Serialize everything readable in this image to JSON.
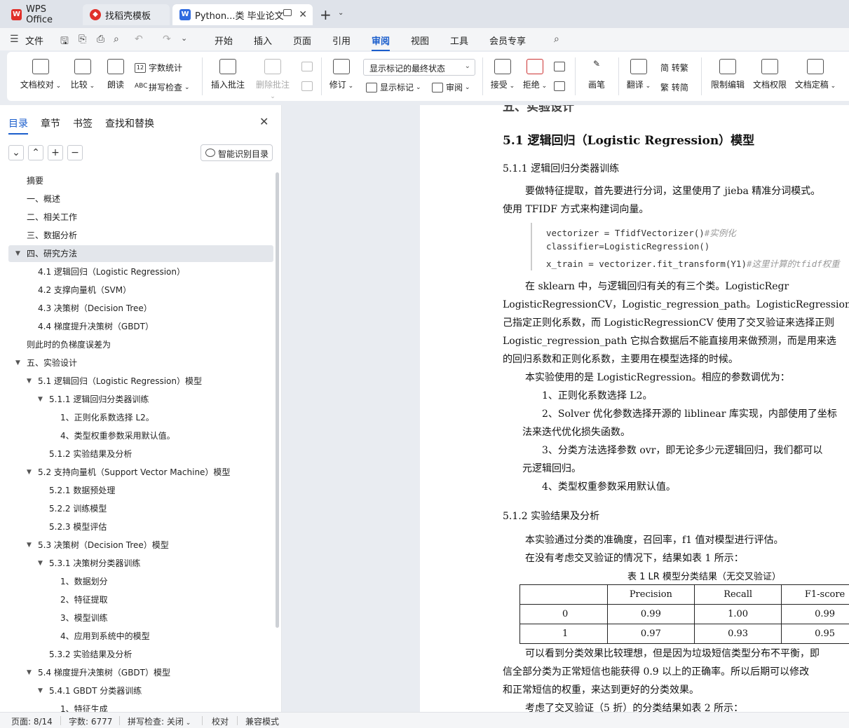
{
  "tabs": {
    "wps": "WPS Office",
    "templates": "找稻壳模板",
    "document": "Python...类 毕业论文"
  },
  "menu": {
    "file": "文件",
    "items": [
      "开始",
      "插入",
      "页面",
      "引用",
      "审阅",
      "视图",
      "工具",
      "会员专享"
    ],
    "active": "审阅"
  },
  "ribbon": {
    "doc_check": "文档校对",
    "compare": "比较",
    "read_aloud": "朗读",
    "word_count": "字数统计",
    "spell_check": "拼写检查",
    "insert_comment": "插入批注",
    "delete_comment": "删除批注",
    "track_changes": "修订",
    "markup_state": "显示标记的最终状态",
    "show_markup": "显示标记",
    "review": "审阅",
    "accept": "接受",
    "reject": "拒绝",
    "pen": "画笔",
    "translate": "翻译",
    "to_traditional": "简 转繁",
    "to_simplified": "繁 转简",
    "restrict_edit": "限制编辑",
    "doc_permission": "文档权限",
    "finalize": "文档定稿"
  },
  "panel": {
    "tabs": [
      "目录",
      "章节",
      "书签",
      "查找和替换"
    ],
    "smart_toc": "智能识别目录",
    "toc": [
      {
        "text": "摘要",
        "level": 0,
        "toggle": ""
      },
      {
        "text": "一、概述",
        "level": 0,
        "toggle": ""
      },
      {
        "text": "二、相关工作",
        "level": 0,
        "toggle": ""
      },
      {
        "text": "三、数据分析",
        "level": 0,
        "toggle": ""
      },
      {
        "text": "四、研究方法",
        "level": 0,
        "toggle": "▼",
        "selected": true
      },
      {
        "text": "4.1 逻辑回归（Logistic Regression）",
        "level": 1,
        "toggle": ""
      },
      {
        "text": "4.2 支撑向量机（SVM）",
        "level": 1,
        "toggle": ""
      },
      {
        "text": "4.3 决策树（Decision Tree）",
        "level": 1,
        "toggle": ""
      },
      {
        "text": "4.4 梯度提升决策树（GBDT）",
        "level": 1,
        "toggle": ""
      },
      {
        "text": "则此时的负梯度误差为",
        "level": 0,
        "toggle": ""
      },
      {
        "text": "五、实验设计",
        "level": 0,
        "toggle": "▼"
      },
      {
        "text": "5.1 逻辑回归（Logistic Regression）模型",
        "level": 1,
        "toggle": "▼"
      },
      {
        "text": "5.1.1 逻辑回归分类器训练",
        "level": 2,
        "toggle": "▼"
      },
      {
        "text": "1、正则化系数选择 L2。",
        "level": 3,
        "toggle": ""
      },
      {
        "text": "4、类型权重参数采用默认值。",
        "level": 3,
        "toggle": ""
      },
      {
        "text": "5.1.2 实验结果及分析",
        "level": 2,
        "toggle": ""
      },
      {
        "text": "5.2 支持向量机（Support Vector Machine）模型",
        "level": 1,
        "toggle": "▼"
      },
      {
        "text": "5.2.1 数据预处理",
        "level": 2,
        "toggle": ""
      },
      {
        "text": "5.2.2 训练模型",
        "level": 2,
        "toggle": ""
      },
      {
        "text": "5.2.3 模型评估",
        "level": 2,
        "toggle": ""
      },
      {
        "text": "5.3 决策树（Decision Tree）模型",
        "level": 1,
        "toggle": "▼"
      },
      {
        "text": "5.3.1 决策树分类器训练",
        "level": 2,
        "toggle": "▼"
      },
      {
        "text": "1、数据划分",
        "level": 3,
        "toggle": ""
      },
      {
        "text": "2、特征提取",
        "level": 3,
        "toggle": ""
      },
      {
        "text": "3、模型训练",
        "level": 3,
        "toggle": ""
      },
      {
        "text": "4、应用到系统中的模型",
        "level": 3,
        "toggle": ""
      },
      {
        "text": "5.3.2 实验结果及分析",
        "level": 2,
        "toggle": ""
      },
      {
        "text": "5.4 梯度提升决策树（GBDT）模型",
        "level": 1,
        "toggle": "▼"
      },
      {
        "text": "5.4.1 GBDT 分类器训练",
        "level": 2,
        "toggle": "▼"
      },
      {
        "text": "1、特征生成",
        "level": 3,
        "toggle": ""
      }
    ]
  },
  "document": {
    "cut_heading": "五、实验设计",
    "h_51": "5.1 逻辑回归（Logistic Regression）模型",
    "h_511": "5.1.1 逻辑回归分类器训练",
    "para1_l1": "要做特征提取，首先要进行分词，这里使用了 jieba 精准分词模式。",
    "para1_l2": "使用 TFIDF 方式来构建词向量。",
    "code": {
      "l1": "vectorizer = TfidfVectorizer()",
      "l1_comment": "#实例化",
      "l2": "classifier=LogisticRegression()",
      "l3": "x_train = vectorizer.fit_transform(Y1)",
      "l3_comment": "#这里计算的tfidf权重"
    },
    "para2": [
      "在 sklearn 中，与逻辑回归有关的有三个类。LogisticRegr",
      "LogisticRegressionCV，Logistic_regression_path。LogisticRegression 需要",
      "己指定正则化系数，而 LogisticRegressionCV 使用了交叉验证来选择正则",
      "Logistic_regression_path 它拟合数据后不能直接用来做预测，而是用来选",
      "的回归系数和正则化系数，主要用在模型选择的时候。"
    ],
    "para3": "本实验使用的是 LogisticRegression。相应的参数调优为：",
    "list1": "1、正则化系数选择 L2。",
    "list2_l1": "2、Solver 优化参数选择开源的 liblinear 库实现，内部使用了坐标",
    "list2_l2": "法来迭代优化损失函数。",
    "list3_l1": "3、分类方法选择参数 ovr，即无论多少元逻辑回归，我们都可以",
    "list3_l2": "元逻辑回归。",
    "list4": "4、类型权重参数采用默认值。",
    "h_512": "5.1.2 实验结果及分析",
    "para4": "本实验通过分类的准确度，召回率，f1 值对模型进行评估。",
    "para5": "在没有考虑交叉验证的情况下，结果如表 1 所示：",
    "table_caption": "表 1 LR 模型分类结果（无交叉验证）",
    "table": {
      "headers": [
        "",
        "Precision",
        "Recall",
        "F1-score"
      ],
      "rows": [
        [
          "0",
          "0.99",
          "1.00",
          "0.99"
        ],
        [
          "1",
          "0.97",
          "0.93",
          "0.95"
        ]
      ]
    },
    "para6_l1": "可以看到分类效果比较理想，但是因为垃圾短信类型分布不平衡，即",
    "para6_l2": "信全部分类为正常短信也能获得 0.9 以上的正确率。所以后期可以修改",
    "para6_l3": "和正常短信的权重，来达到更好的分类效果。",
    "para7": "考虑了交叉验证（5 折）的分类结果如表 2 所示："
  },
  "status": {
    "page": "页面: 8/14",
    "words": "字数: 6777",
    "spell": "拼写检查: 关闭",
    "proofread": "校对",
    "compat": "兼容模式"
  }
}
